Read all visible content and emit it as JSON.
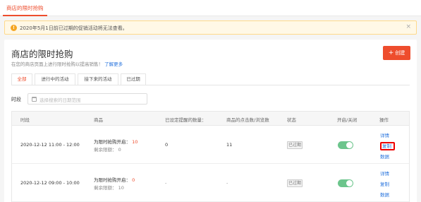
{
  "top_nav": {
    "active_tab": "商店的限时抢购"
  },
  "notice": {
    "text": "2020年5月1日前已过期的促销活动将无法查看。",
    "close": "×"
  },
  "header": {
    "title": "商店的限时抢购",
    "subtitle": "在您的商店页面上进行限时抢购以提高销售！",
    "learn_more": "了解更多",
    "create_button": "创建",
    "create_icon": "+"
  },
  "tabs": [
    "全部",
    "进行中的活动",
    "接下来的活动",
    "已过期"
  ],
  "filter": {
    "label": "时段",
    "placeholder": "选择搜索的日期范围"
  },
  "table": {
    "columns": [
      "时段",
      "商品",
      "已设定提醒的数量：",
      "商品的点击数/浏览数",
      "状态",
      "开启/关闭",
      "操作"
    ],
    "rows": [
      {
        "period": "2020-12-12 11:00 - 12:00",
        "enabled_label": "为限时抢购开启：",
        "enabled_count": "10",
        "remaining": "剩余限额： 0",
        "reminders": "0",
        "clicks": "11",
        "status": "已过期",
        "toggle_on": true,
        "actions": [
          "详情",
          "复制",
          "数据"
        ]
      },
      {
        "period": "2020-12-12 09:00 - 10:00",
        "enabled_label": "为限时抢购开启：",
        "enabled_count": "0",
        "remaining": "剩余限额： 10",
        "reminders": "-",
        "clicks": "-",
        "status": "已过期",
        "toggle_on": true,
        "actions": [
          "详情",
          "复制",
          "数据"
        ]
      }
    ]
  },
  "colors": {
    "accent": "#ee4d2d",
    "link": "#2673dd",
    "toggle_on": "#6cc58c",
    "notice_bg": "#fff8e6"
  }
}
